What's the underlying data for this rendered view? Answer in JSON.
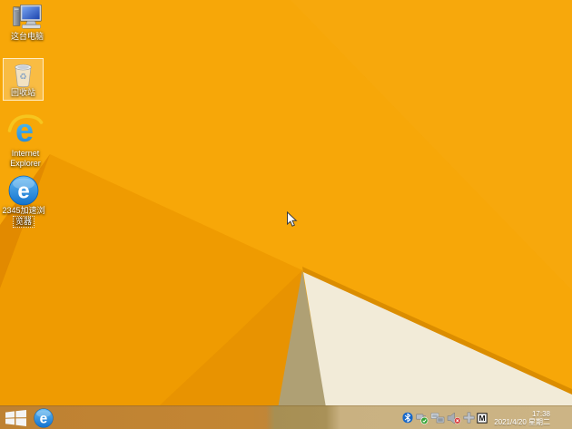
{
  "wallpaper": {
    "base": "#F7A708",
    "facet_top_right": "#F8AA10",
    "facet_mid": "#EF9B01",
    "facet_sub": "#E89301",
    "wedge": "#E28A00",
    "ridge": "#DB8D00",
    "tan": "#AFA074",
    "cream": "#F2EBD8"
  },
  "desktop_icons": [
    {
      "id": "this-pc",
      "label": "这台电脑"
    },
    {
      "id": "recycle-bin",
      "label": "回收站",
      "selected": true
    },
    {
      "id": "internet-explorer",
      "label": "Internet Explorer",
      "label_line1": "Internet",
      "label_line2": "Explorer",
      "glyph": "e"
    },
    {
      "id": "browser-2345",
      "label": "2345加速浏览器",
      "label_line1": "2345加速浏",
      "label_line2": "览器",
      "glyph": "e"
    }
  ],
  "taskbar": {
    "pinned_browser_glyph": "e",
    "tray": [
      {
        "id": "bluetooth-icon"
      },
      {
        "id": "safely-remove-hardware-icon"
      },
      {
        "id": "network-icon"
      },
      {
        "id": "volume-muted-icon"
      },
      {
        "id": "input-switcher-icon"
      },
      {
        "id": "ime-mode-icon",
        "label": "M"
      }
    ],
    "clock": {
      "time": "17:38",
      "date": "2021/4/20 星期二"
    }
  }
}
